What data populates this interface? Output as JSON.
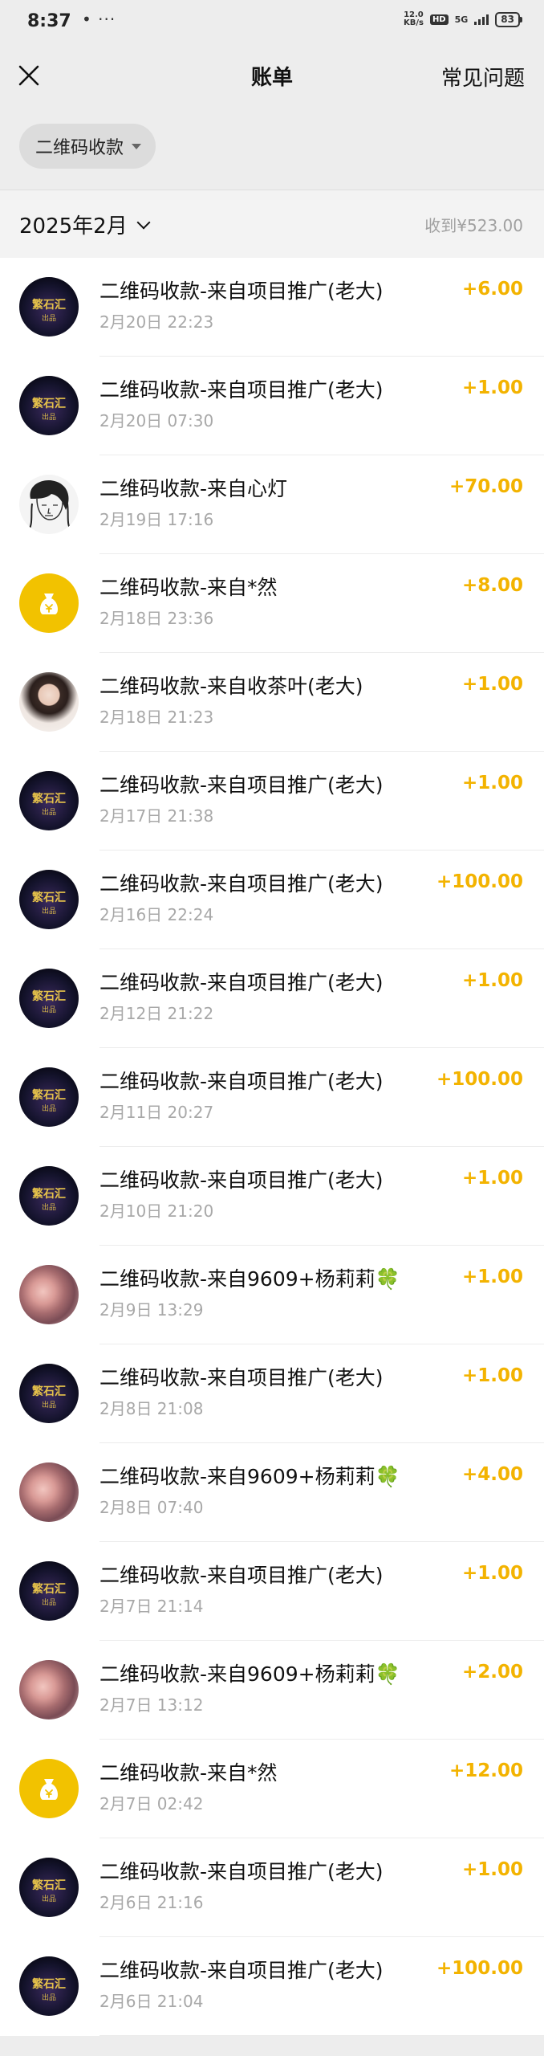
{
  "status_bar": {
    "time": "8:37",
    "dots": "• ···",
    "net_speed": "12.0",
    "net_unit": "KB/s",
    "hd": "HD",
    "network": "5G",
    "battery": "83"
  },
  "nav": {
    "title": "账单",
    "faq": "常见问题"
  },
  "filter": {
    "chip_label": "二维码收款"
  },
  "month": {
    "label": "2025年2月",
    "total": "收到¥523.00"
  },
  "colors": {
    "amount": "#f3b300",
    "background": "#ededed"
  },
  "avatars": {
    "orb_text": "繁石汇",
    "orb_sub": "出品"
  },
  "transactions": [
    {
      "title": "二维码收款-来自项目推广(老大)",
      "time": "2月20日 22:23",
      "amount": "+6.00",
      "avatar": "orb-logo"
    },
    {
      "title": "二维码收款-来自项目推广(老大)",
      "time": "2月20日 07:30",
      "amount": "+1.00",
      "avatar": "orb-logo"
    },
    {
      "title": "二维码收款-来自心灯",
      "time": "2月19日 17:16",
      "amount": "+70.00",
      "avatar": "sketch-portrait"
    },
    {
      "title": "二维码收款-来自*然",
      "time": "2月18日 23:36",
      "amount": "+8.00",
      "avatar": "money-bag-icon"
    },
    {
      "title": "二维码收款-来自收茶叶(老大)",
      "time": "2月18日 21:23",
      "amount": "+1.00",
      "avatar": "girl-photo"
    },
    {
      "title": "二维码收款-来自项目推广(老大)",
      "time": "2月17日 21:38",
      "amount": "+1.00",
      "avatar": "orb-logo"
    },
    {
      "title": "二维码收款-来自项目推广(老大)",
      "time": "2月16日 22:24",
      "amount": "+100.00",
      "avatar": "orb-logo"
    },
    {
      "title": "二维码收款-来自项目推广(老大)",
      "time": "2月12日 21:22",
      "amount": "+1.00",
      "avatar": "orb-logo"
    },
    {
      "title": "二维码收款-来自项目推广(老大)",
      "time": "2月11日 20:27",
      "amount": "+100.00",
      "avatar": "orb-logo"
    },
    {
      "title": "二维码收款-来自项目推广(老大)",
      "time": "2月10日 21:20",
      "amount": "+1.00",
      "avatar": "orb-logo"
    },
    {
      "title": "二维码收款-来自9609+杨莉莉🍀",
      "time": "2月9日 13:29",
      "amount": "+1.00",
      "avatar": "hands-photo"
    },
    {
      "title": "二维码收款-来自项目推广(老大)",
      "time": "2月8日 21:08",
      "amount": "+1.00",
      "avatar": "orb-logo"
    },
    {
      "title": "二维码收款-来自9609+杨莉莉🍀",
      "time": "2月8日 07:40",
      "amount": "+4.00",
      "avatar": "hands-photo"
    },
    {
      "title": "二维码收款-来自项目推广(老大)",
      "time": "2月7日 21:14",
      "amount": "+1.00",
      "avatar": "orb-logo"
    },
    {
      "title": "二维码收款-来自9609+杨莉莉🍀",
      "time": "2月7日 13:12",
      "amount": "+2.00",
      "avatar": "hands-photo"
    },
    {
      "title": "二维码收款-来自*然",
      "time": "2月7日 02:42",
      "amount": "+12.00",
      "avatar": "money-bag-icon"
    },
    {
      "title": "二维码收款-来自项目推广(老大)",
      "time": "2月6日 21:16",
      "amount": "+1.00",
      "avatar": "orb-logo"
    },
    {
      "title": "二维码收款-来自项目推广(老大)",
      "time": "2月6日 21:04",
      "amount": "+100.00",
      "avatar": "orb-logo"
    }
  ]
}
